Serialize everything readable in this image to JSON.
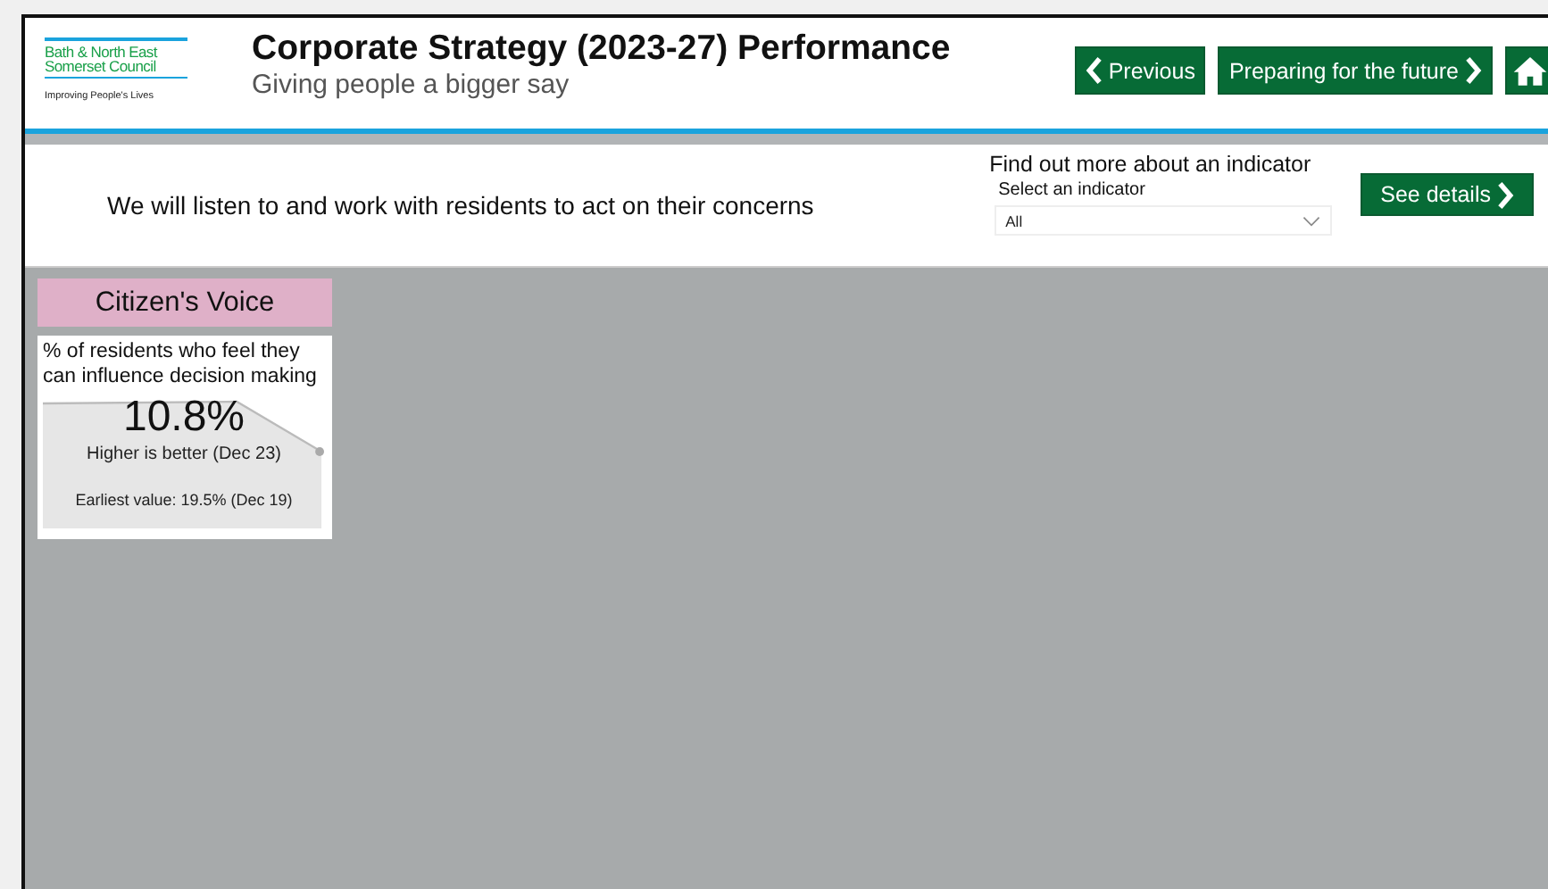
{
  "logo": {
    "name_lines": [
      "Bath & North East",
      "Somerset Council"
    ],
    "tagline": "Improving People's Lives"
  },
  "header": {
    "title": "Corporate Strategy (2023-27) Performance",
    "subtitle": "Giving people a bigger say"
  },
  "nav": {
    "previous": "Previous",
    "next": "Preparing for the future"
  },
  "intro": {
    "statement": "We will listen to and work with residents to act on their concerns",
    "finder_title": "Find out more about an indicator",
    "select_label": "Select an indicator",
    "select_value": "All",
    "details_button": "See details"
  },
  "groups": [
    {
      "title": "Citizen's Voice",
      "color": "#dfb0c8",
      "cards": [
        {
          "name": "% of residents who feel they can influence decision making",
          "value": "10.8%",
          "note": "Higher is better (Dec 23)",
          "earliest": "Earliest value: 19.5% (Dec 19)"
        }
      ]
    }
  ]
}
